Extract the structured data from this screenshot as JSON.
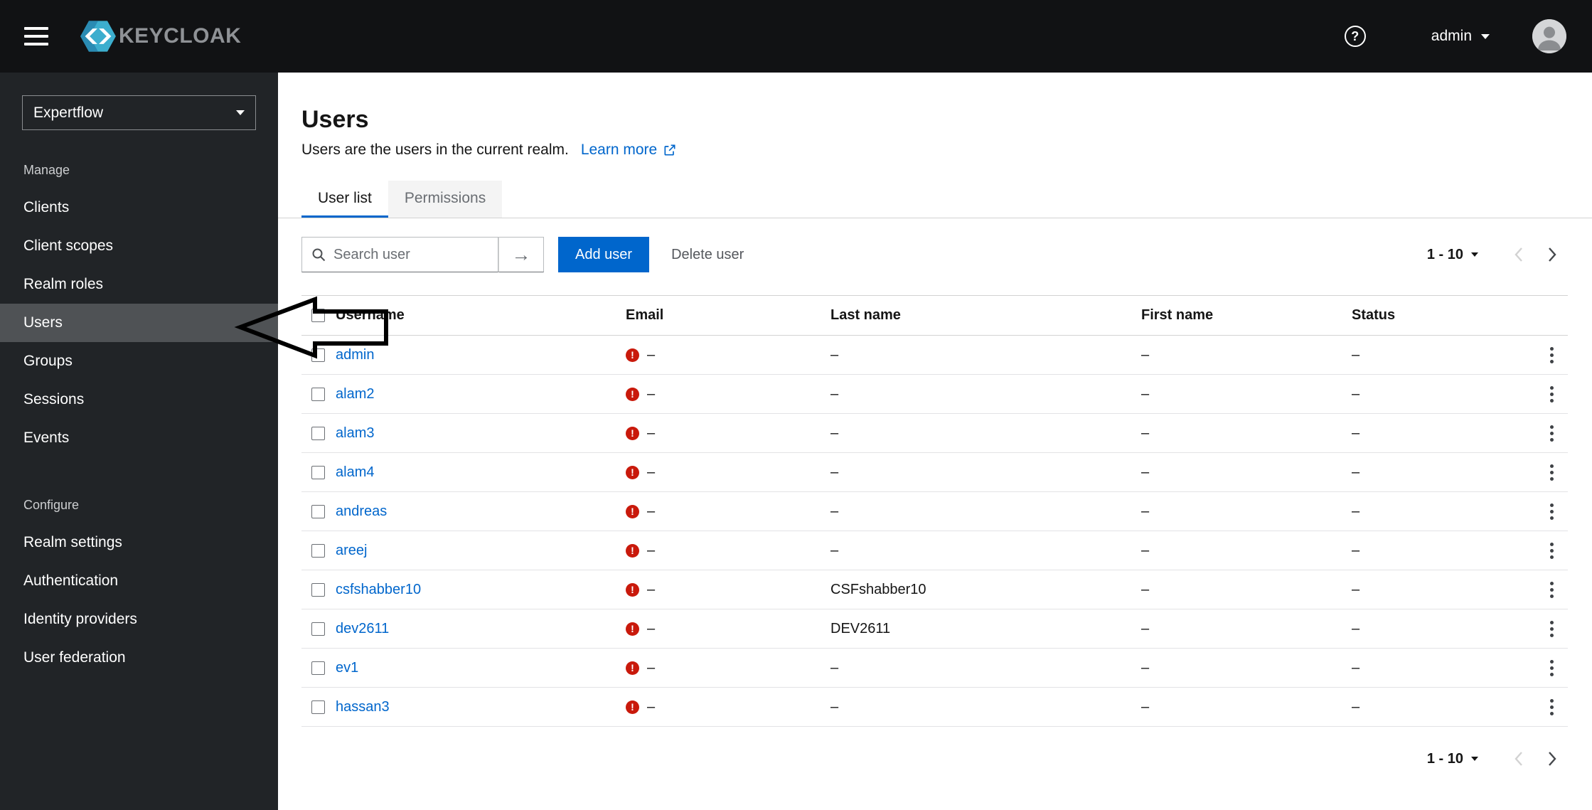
{
  "masthead": {
    "brand": "KEYCLOAK",
    "help": "?",
    "user": "admin"
  },
  "sidebar": {
    "realm": "Expertflow",
    "selected": "Users",
    "sections": [
      {
        "label": "Manage",
        "items": [
          "Clients",
          "Client scopes",
          "Realm roles",
          "Users",
          "Groups",
          "Sessions",
          "Events"
        ]
      },
      {
        "label": "Configure",
        "items": [
          "Realm settings",
          "Authentication",
          "Identity providers",
          "User federation"
        ]
      }
    ]
  },
  "page": {
    "title": "Users",
    "subtitle": "Users are the users in the current realm.",
    "learn_more": "Learn more",
    "tabs": [
      {
        "label": "User list",
        "active": true
      },
      {
        "label": "Permissions",
        "active": false
      }
    ],
    "toolbar": {
      "search_placeholder": "Search user",
      "add_user": "Add user",
      "delete_user": "Delete user"
    },
    "pagination": {
      "range": "1 - 10"
    },
    "table": {
      "columns": [
        "Username",
        "Email",
        "Last name",
        "First name",
        "Status"
      ],
      "rows": [
        {
          "username": "admin",
          "email": "–",
          "last_name": "–",
          "first_name": "–",
          "status": "–"
        },
        {
          "username": "alam2",
          "email": "–",
          "last_name": "–",
          "first_name": "–",
          "status": "–"
        },
        {
          "username": "alam3",
          "email": "–",
          "last_name": "–",
          "first_name": "–",
          "status": "–"
        },
        {
          "username": "alam4",
          "email": "–",
          "last_name": "–",
          "first_name": "–",
          "status": "–"
        },
        {
          "username": "andreas",
          "email": "–",
          "last_name": "–",
          "first_name": "–",
          "status": "–"
        },
        {
          "username": "areej",
          "email": "–",
          "last_name": "–",
          "first_name": "–",
          "status": "–"
        },
        {
          "username": "csfshabber10",
          "email": "–",
          "last_name": "CSFshabber10",
          "first_name": "–",
          "status": "–"
        },
        {
          "username": "dev2611",
          "email": "–",
          "last_name": "DEV2611",
          "first_name": "–",
          "status": "–"
        },
        {
          "username": "ev1",
          "email": "–",
          "last_name": "–",
          "first_name": "–",
          "status": "–"
        },
        {
          "username": "hassan3",
          "email": "–",
          "last_name": "–",
          "first_name": "–",
          "status": "–"
        }
      ]
    }
  },
  "colors": {
    "accent": "#0066cc",
    "danger": "#c9190b",
    "masthead_bg": "#111214",
    "sidebar_bg": "#212427"
  }
}
